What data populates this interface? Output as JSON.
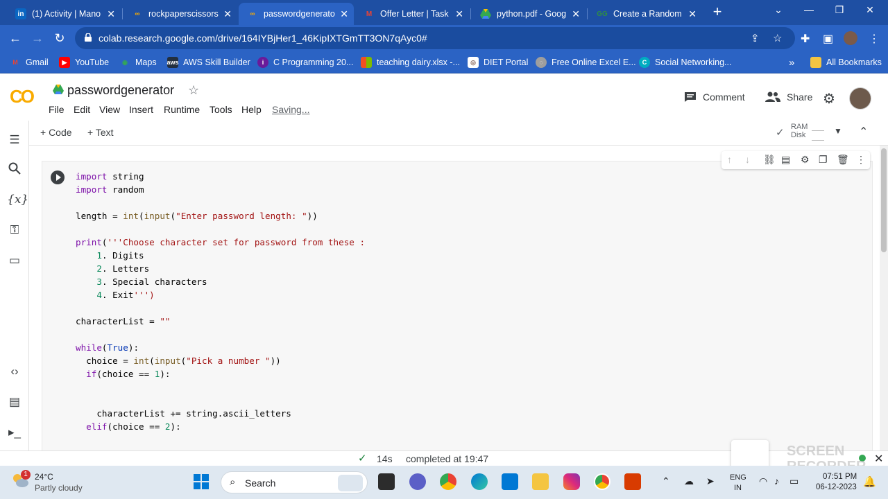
{
  "browser": {
    "tabs": [
      {
        "label": "(1) Activity | Mano",
        "favicon": "linkedin-icon",
        "color": "#0a66c2"
      },
      {
        "label": "rockpaperscissors",
        "favicon": "colab-icon",
        "color": "#f9ab00"
      },
      {
        "label": "passwordgenerato",
        "favicon": "colab-icon",
        "color": "#f9ab00"
      },
      {
        "label": "Offer Letter | Task",
        "favicon": "gmail-icon",
        "color": "#ea4335"
      },
      {
        "label": "python.pdf - Goog",
        "favicon": "drive-icon",
        "color": "#34a853"
      },
      {
        "label": "Create a Random",
        "favicon": "geeks-icon",
        "color": "#2f8d46"
      }
    ],
    "url": "colab.research.google.com/drive/164IYBjHer1_46KipIXTGmTT3ON7qAyc0#",
    "bookmarks": [
      {
        "label": "Gmail",
        "color": "#ea4335"
      },
      {
        "label": "YouTube",
        "color": "#ff0000"
      },
      {
        "label": "Maps",
        "color": "#34a853"
      },
      {
        "label": "AWS Skill Builder",
        "color": "#232f3e"
      },
      {
        "label": "C Programming 20...",
        "color": "#6a1b9a"
      },
      {
        "label": "teaching dairy.xlsx -...",
        "color": "#f4b400"
      },
      {
        "label": "DIET Portal",
        "color": "#8d6e63"
      },
      {
        "label": "Free Online Excel E...",
        "color": "#9e9e9e"
      },
      {
        "label": "Social Networking...",
        "color": "#00acc1"
      }
    ],
    "bookmarks_overflow": "»",
    "all_bookmarks": "All Bookmarks"
  },
  "colab": {
    "logo": "CO",
    "title": "passwordgenerator",
    "menus": [
      "File",
      "Edit",
      "View",
      "Insert",
      "Runtime",
      "Tools",
      "Help"
    ],
    "saving": "Saving...",
    "comment": "Comment",
    "share": "Share",
    "add_code": "+ Code",
    "add_text": "+ Text",
    "ram": "RAM",
    "disk": "Disk"
  },
  "cell": {
    "code_lines": [
      "import string",
      "import random",
      "",
      "length = int(input(\"Enter password length: \"))",
      "",
      "print('''Choose character set for password from these :",
      "    1. Digits",
      "    2. Letters",
      "    3. Special characters",
      "    4. Exit''')",
      "",
      "characterList = \"\"",
      "",
      "while(True):",
      "  choice = int(input(\"Pick a number \"))",
      "  if(choice == 1):",
      "",
      "",
      "    characterList += string.ascii_letters",
      "  elif(choice == 2):"
    ]
  },
  "status": {
    "duration": "14s",
    "completed": "completed at 19:47"
  },
  "taskbar": {
    "temp": "24°C",
    "weather": "Partly cloudy",
    "badge": "1",
    "search": "Search",
    "lang1": "ENG",
    "lang2": "IN",
    "time": "07:51 PM",
    "date": "06-12-2023"
  },
  "watermark": [
    "SCREEN",
    "RECORDER"
  ]
}
